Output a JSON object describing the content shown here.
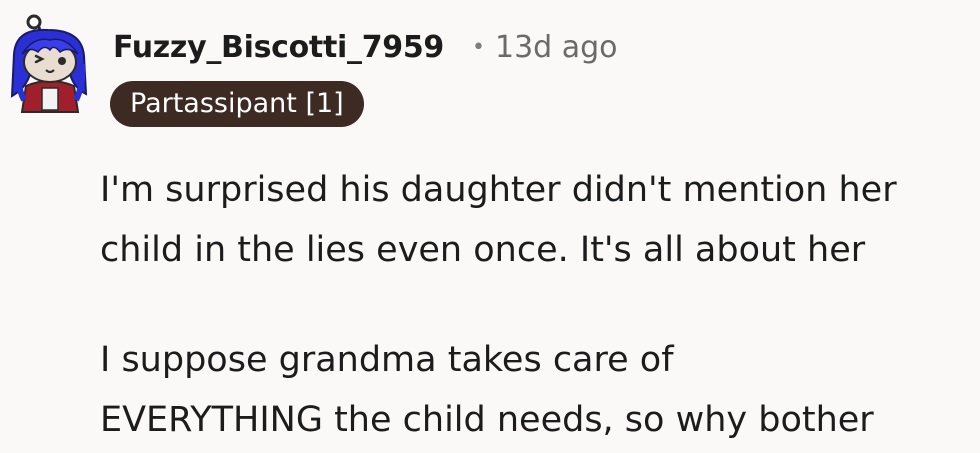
{
  "comment": {
    "author": "Fuzzy_Biscotti_7959",
    "separator": "•",
    "timestamp": "13d ago",
    "flair": "Partassipant [1]",
    "paragraphs": [
      {
        "lines": [
          "I'm surprised his daughter didn't mention her",
          "child in the lies even once. It's all about her"
        ]
      },
      {
        "lines": [
          "I suppose grandma takes care of",
          "EVERYTHING the child needs, so why bother"
        ]
      }
    ]
  },
  "colors": {
    "background": "#faf9f8",
    "flair_background": "#3d2a22",
    "avatar_hair": "#2b2fd6",
    "avatar_face": "#e9dcd0"
  },
  "icons": {
    "avatar": "snoo-avatar-icon"
  }
}
